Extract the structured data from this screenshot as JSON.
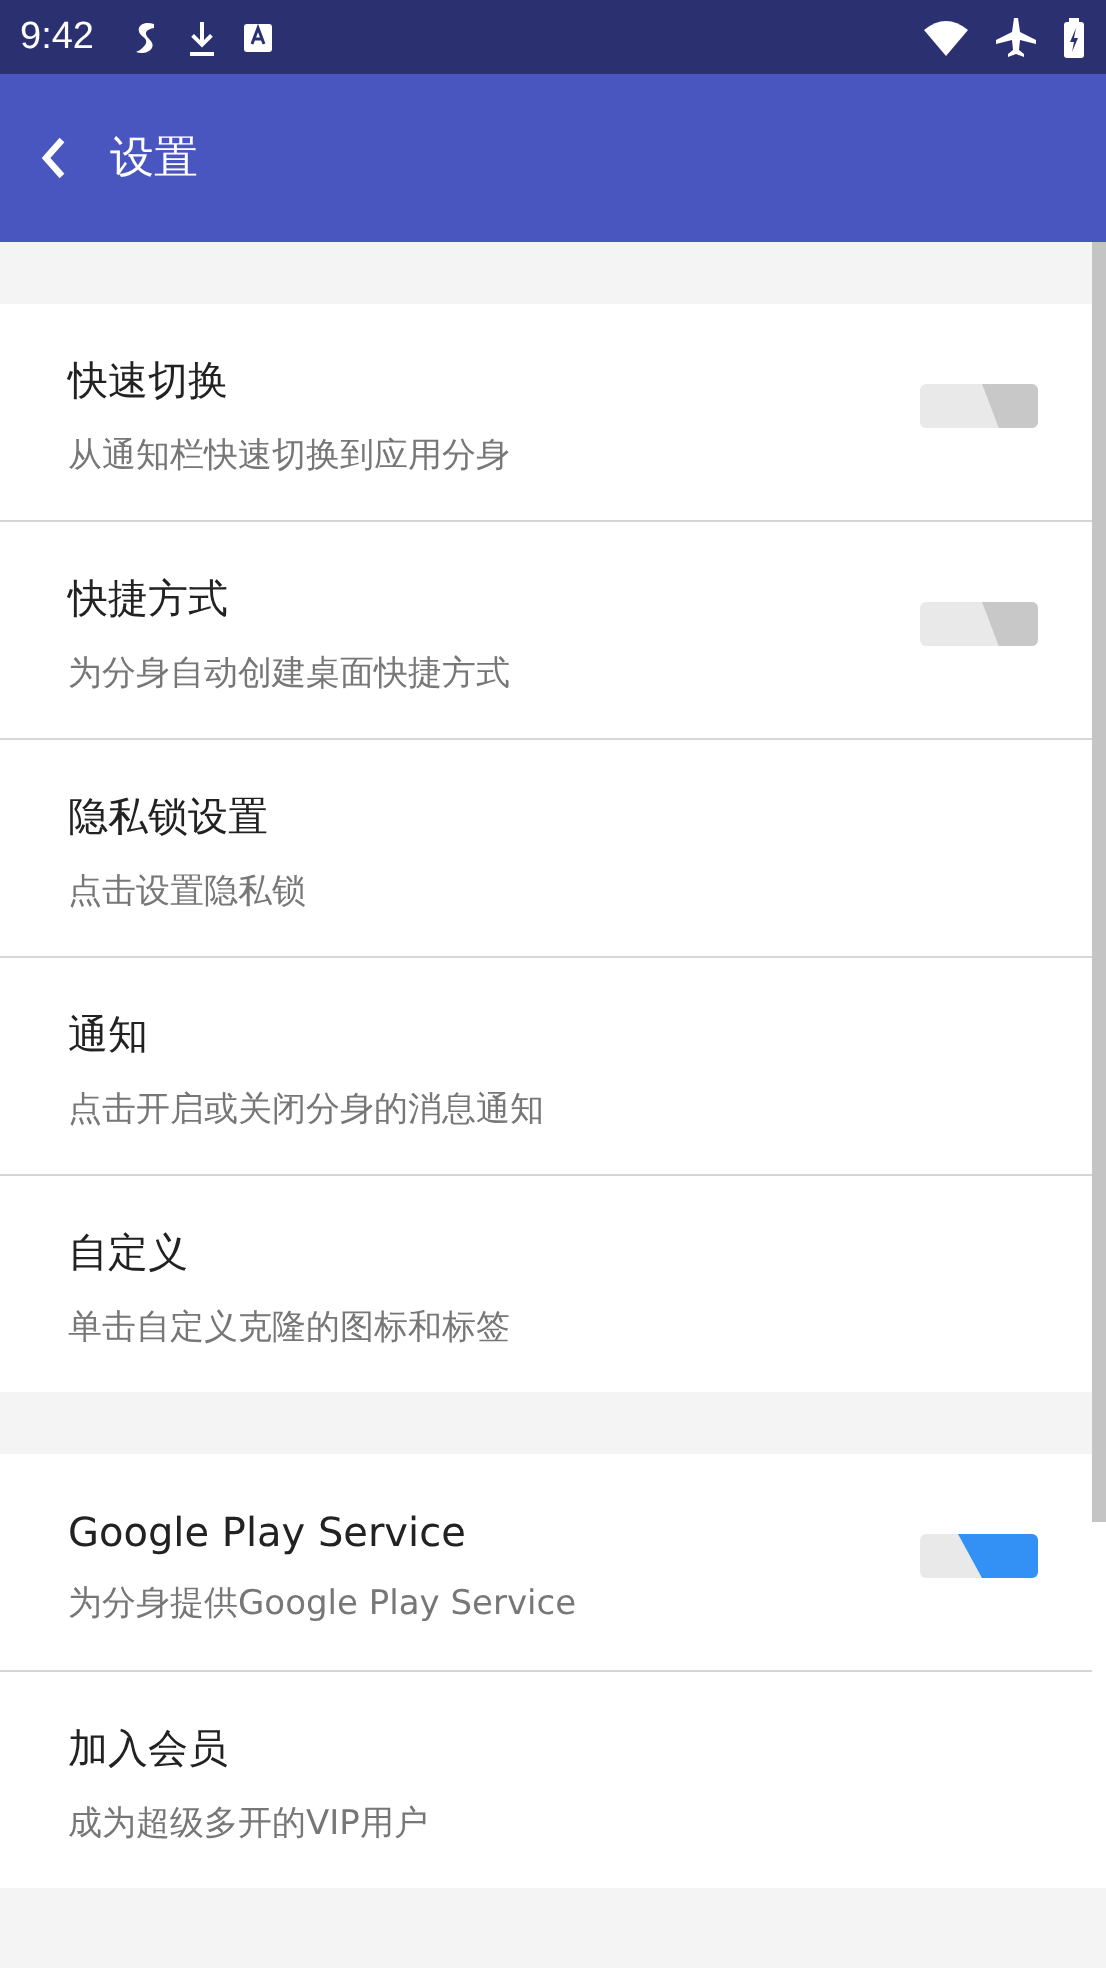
{
  "status_bar": {
    "time": "9:42"
  },
  "app_bar": {
    "title": "设置"
  },
  "groups": [
    {
      "items": [
        {
          "kind": "toggle",
          "title": "快速切换",
          "subtitle": "从通知栏快速切换到应用分身",
          "on": false
        },
        {
          "kind": "toggle",
          "title": "快捷方式",
          "subtitle": "为分身自动创建桌面快捷方式",
          "on": false
        },
        {
          "kind": "plain",
          "title": "隐私锁设置",
          "subtitle": "点击设置隐私锁"
        },
        {
          "kind": "plain",
          "title": "通知",
          "subtitle": "点击开启或关闭分身的消息通知"
        },
        {
          "kind": "plain",
          "title": "自定义",
          "subtitle": "单击自定义克隆的图标和标签"
        }
      ]
    },
    {
      "items": [
        {
          "kind": "toggle",
          "title": "Google Play Service",
          "subtitle": "为分身提供Google Play Service",
          "on": true
        },
        {
          "kind": "plain",
          "title": "加入会员",
          "subtitle": "成为超级多开的VIP用户"
        }
      ]
    }
  ]
}
